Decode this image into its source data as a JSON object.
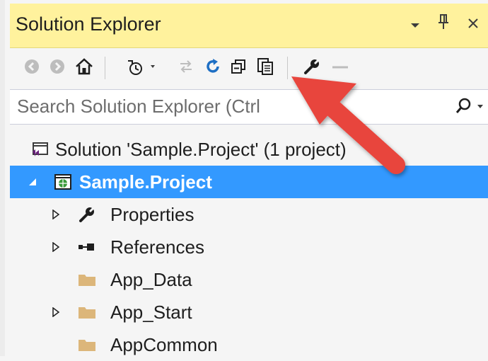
{
  "panel": {
    "title": "Solution Explorer",
    "dropdown_icon": "chevron-down-icon",
    "pin_icon": "pin-icon",
    "close_icon": "close-icon"
  },
  "toolbar": {
    "icons": [
      "back-icon",
      "forward-icon",
      "home-icon",
      "pending-changes-icon",
      "sync-icon",
      "refresh-icon",
      "collapse-all-icon",
      "show-all-files-icon",
      "properties-wrench-icon",
      "preview-icon"
    ]
  },
  "search": {
    "placeholder": "Search Solution Explorer (Ctrl+;)",
    "visible_text": "Search Solution Explorer (Ctrl",
    "icon": "search-icon"
  },
  "tree": {
    "solution": "Solution 'Sample.Project' (1 project)",
    "items": [
      {
        "label": "Sample.Project",
        "icon": "web-project-icon",
        "expanded": true,
        "selected": true
      },
      {
        "label": "Properties",
        "icon": "wrench-icon",
        "expandable": true
      },
      {
        "label": "References",
        "icon": "references-icon",
        "expandable": true
      },
      {
        "label": "App_Data",
        "icon": "folder-icon",
        "expandable": false
      },
      {
        "label": "App_Start",
        "icon": "folder-icon",
        "expandable": true
      },
      {
        "label": "AppCommon",
        "icon": "folder-icon",
        "expandable": false
      }
    ]
  },
  "colors": {
    "title_bar": "#fff29d",
    "selection": "#3399ff",
    "arrow": "#e8453c",
    "folder": "#dcb67a"
  }
}
